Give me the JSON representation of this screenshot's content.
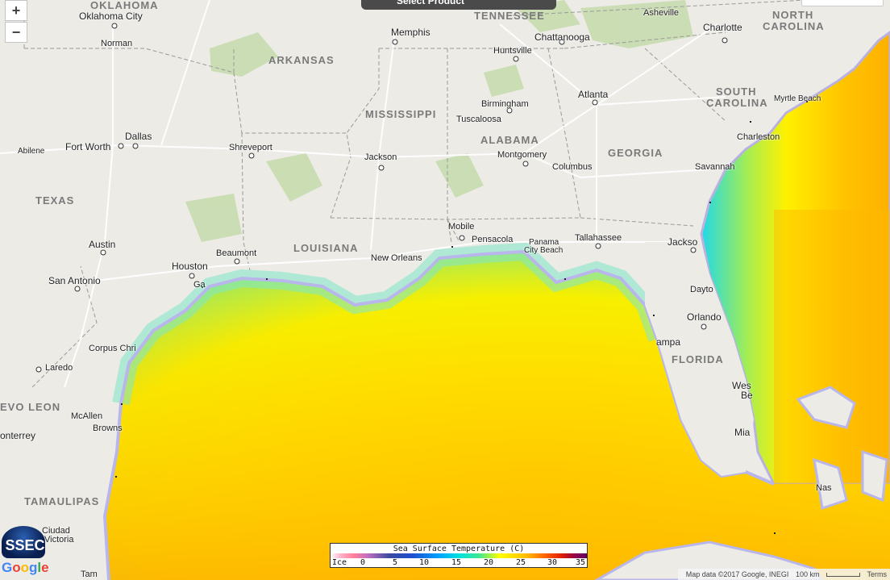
{
  "map": {
    "top_control_text": "Select Product",
    "zoom_in": "+",
    "zoom_out": "−",
    "state_labels": [
      {
        "id": "oklahoma",
        "text": "OKLAHOMA"
      },
      {
        "id": "arkansas",
        "text": "ARKANSAS"
      },
      {
        "id": "tennessee",
        "text": "TENNESSEE"
      },
      {
        "id": "north-carolina-1",
        "text": "NORTH"
      },
      {
        "id": "north-carolina-2",
        "text": "CAROLINA"
      },
      {
        "id": "mississippi",
        "text": "MISSISSIPPI"
      },
      {
        "id": "south-carolina-1",
        "text": "SOUTH"
      },
      {
        "id": "south-carolina-2",
        "text": "CAROLINA"
      },
      {
        "id": "alabama",
        "text": "ALABAMA"
      },
      {
        "id": "georgia",
        "text": "GEORGIA"
      },
      {
        "id": "texas",
        "text": "TEXAS"
      },
      {
        "id": "louisiana",
        "text": "LOUISIANA"
      },
      {
        "id": "florida",
        "text": "FLORIDA"
      },
      {
        "id": "nuevo-leon",
        "text": "EVO LEON"
      },
      {
        "id": "tamaulipas",
        "text": "TAMAULIPAS"
      }
    ],
    "city_labels": [
      {
        "id": "oklahoma-city",
        "text": "Oklahoma City"
      },
      {
        "id": "norman",
        "text": "Norman"
      },
      {
        "id": "memphis",
        "text": "Memphis"
      },
      {
        "id": "chattanooga",
        "text": "Chattanooga"
      },
      {
        "id": "asheville",
        "text": "Asheville"
      },
      {
        "id": "charlotte",
        "text": "Charlotte"
      },
      {
        "id": "huntsville",
        "text": "Huntsville"
      },
      {
        "id": "atlanta",
        "text": "Atlanta"
      },
      {
        "id": "birmingham",
        "text": "Birmingham"
      },
      {
        "id": "tuscaloosa",
        "text": "Tuscaloosa"
      },
      {
        "id": "myrtle-beach",
        "text": "Myrtle Beach"
      },
      {
        "id": "dallas",
        "text": "Dallas"
      },
      {
        "id": "fort-worth",
        "text": "Fort Worth"
      },
      {
        "id": "abilene",
        "text": "Abilene"
      },
      {
        "id": "shreveport",
        "text": "Shreveport"
      },
      {
        "id": "jackson-ms",
        "text": "Jackson"
      },
      {
        "id": "montgomery",
        "text": "Montgomery"
      },
      {
        "id": "columbus",
        "text": "Columbus"
      },
      {
        "id": "charleston",
        "text": "Charleston"
      },
      {
        "id": "savannah",
        "text": "Savannah"
      },
      {
        "id": "mobile",
        "text": "Mobile"
      },
      {
        "id": "pensacola",
        "text": "Pensacola"
      },
      {
        "id": "panama-city-1",
        "text": "Panama"
      },
      {
        "id": "panama-city-2",
        "text": "City Beach"
      },
      {
        "id": "tallahassee",
        "text": "Tallahassee"
      },
      {
        "id": "jacksonville",
        "text": "Jackso"
      },
      {
        "id": "austin",
        "text": "Austin"
      },
      {
        "id": "beaumont",
        "text": "Beaumont"
      },
      {
        "id": "houston",
        "text": "Houston"
      },
      {
        "id": "new-orleans",
        "text": "New Orleans"
      },
      {
        "id": "san-antonio",
        "text": "San Antonio"
      },
      {
        "id": "galveston",
        "text": "Ga"
      },
      {
        "id": "daytona",
        "text": "Dayto"
      },
      {
        "id": "orlando",
        "text": "Orlando"
      },
      {
        "id": "corpus-christi",
        "text": "Corpus Chri"
      },
      {
        "id": "tampa",
        "text": "ampa"
      },
      {
        "id": "laredo",
        "text": "Laredo"
      },
      {
        "id": "west-palm-1",
        "text": "Wes"
      },
      {
        "id": "west-palm-2",
        "text": "Be"
      },
      {
        "id": "mcallen",
        "text": "McAllen"
      },
      {
        "id": "brownsville",
        "text": "Browns"
      },
      {
        "id": "monterrey",
        "text": "onterrey"
      },
      {
        "id": "miami",
        "text": "Mia"
      },
      {
        "id": "nassau",
        "text": "Nas"
      },
      {
        "id": "ciudad-victoria-1",
        "text": "Ciudad"
      },
      {
        "id": "ciudad-victoria-2",
        "text": "Victoria"
      },
      {
        "id": "tampico",
        "text": "Tam"
      }
    ]
  },
  "legend": {
    "title": "Sea Surface Temperature (C)",
    "ticks": [
      "Ice",
      "0",
      "5",
      "10",
      "15",
      "20",
      "25",
      "30",
      "35"
    ]
  },
  "logo": {
    "ssec": "SSEC",
    "google": "Google"
  },
  "footer": {
    "map_data": "Map data ©2017 Google, INEGI",
    "scale": "100 km",
    "terms": "Terms"
  }
}
